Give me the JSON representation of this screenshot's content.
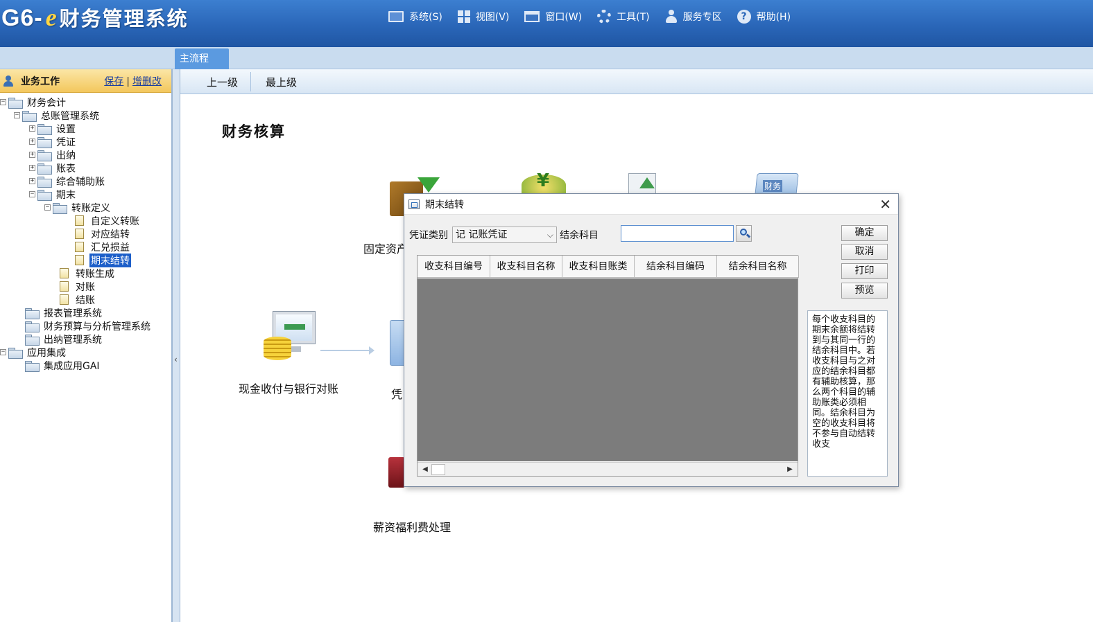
{
  "header": {
    "brand": "G6-",
    "brand_e": "e",
    "title": "财务管理系统",
    "menus": [
      {
        "label": "系统(S)",
        "icon": "monitor-icon"
      },
      {
        "label": "视图(V)",
        "icon": "grid-icon"
      },
      {
        "label": "窗口(W)",
        "icon": "window-icon"
      },
      {
        "label": "工具(T)",
        "icon": "gear-icon"
      },
      {
        "label": "服务专区",
        "icon": "user-icon"
      },
      {
        "label": "帮助(H)",
        "icon": "help-icon"
      }
    ]
  },
  "tabs": {
    "main": "主流程"
  },
  "sidebar": {
    "title": "业务工作",
    "link_save": "保存",
    "link_edit": "增删改",
    "separator": "|",
    "tree": [
      {
        "label": "财务会计",
        "expander": "−"
      },
      {
        "label": "总账管理系统",
        "expander": "−"
      },
      {
        "label": "设置",
        "expander": "+"
      },
      {
        "label": "凭证",
        "expander": "+"
      },
      {
        "label": "出纳",
        "expander": "+"
      },
      {
        "label": "账表",
        "expander": "+"
      },
      {
        "label": "综合辅助账",
        "expander": "+"
      },
      {
        "label": "期末",
        "expander": "−"
      },
      {
        "label": "转账定义",
        "expander": "−"
      },
      {
        "label": "自定义转账"
      },
      {
        "label": "对应结转"
      },
      {
        "label": "汇兑损益"
      },
      {
        "label": "期末结转"
      },
      {
        "label": "转账生成"
      },
      {
        "label": "对账"
      },
      {
        "label": "结账"
      },
      {
        "label": "报表管理系统"
      },
      {
        "label": "财务预算与分析管理系统"
      },
      {
        "label": "出纳管理系统"
      },
      {
        "label": "应用集成",
        "expander": "−"
      },
      {
        "label": "集成应用GAI"
      }
    ]
  },
  "toolbar": {
    "up": "上一级",
    "top": "最上级"
  },
  "content": {
    "title": "财务核算",
    "labels": {
      "fixed_assets": "固定资产",
      "cash_bank": "现金收付与银行对账",
      "voucher": "凭",
      "salary": "薪资福利费处理",
      "finance_tag": "财务"
    }
  },
  "dialog": {
    "title": "期末结转",
    "voucher_type_label": "凭证类别",
    "voucher_type_value": "记  记账凭证",
    "balance_subject_label": "结余科目",
    "balance_subject_value": "",
    "buttons": {
      "ok": "确定",
      "cancel": "取消",
      "print": "打印",
      "preview": "预览"
    },
    "columns": [
      "收支科目编号",
      "收支科目名称",
      "收支科目账类",
      "结余科目编码",
      "结余科目名称"
    ],
    "hint": "每个收支科目的期末余额将结转到与其同一行的结余科目中。若收支科目与之对应的结余科目都有辅助核算，那么两个科目的辅助账类必须相同。结余科目为空的收支科目将不参与自动结转收支"
  },
  "colors": {
    "header_blue": "#2a66b8",
    "tab_blue": "#5b9ae0",
    "selection_blue": "#1d5fc9",
    "grid_body_gray": "#7c7c7c"
  }
}
